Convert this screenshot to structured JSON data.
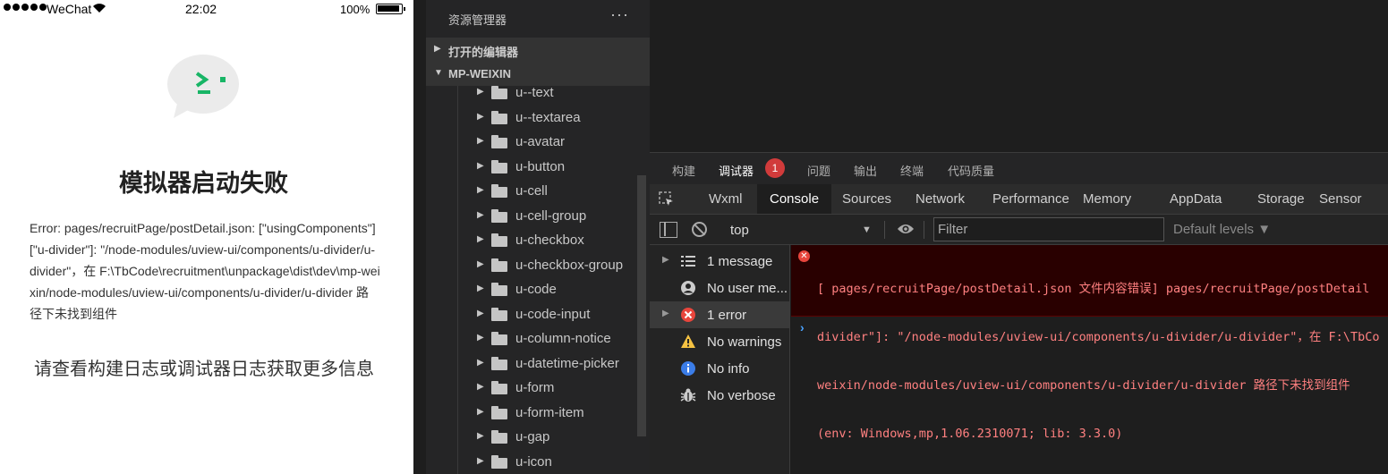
{
  "statusbar": {
    "carrier": "WeChat",
    "time": "22:02",
    "battery": "100%"
  },
  "simulator": {
    "title": "模拟器启动失败",
    "error": "Error: pages/recruitPage/postDetail.json: [\"usingComponents\"][\"u-divider\"]: \"/node-modules/uview-ui/components/u-divider/u-divider\"，在 F:\\TbCode\\recruitment\\unpackage\\dist\\dev\\mp-weixin/node-modules/uview-ui/components/u-divider/u-divider 路径下未找到组件",
    "hint": "请查看构建日志或调试器日志获取更多信息"
  },
  "explorer": {
    "title": "资源管理器",
    "more": "···",
    "sections": [
      {
        "label": "打开的编辑器",
        "arrow": "▶"
      },
      {
        "label": "MP-WEIXIN",
        "arrow": "▼"
      }
    ],
    "items": [
      "u--text",
      "u--textarea",
      "u-avatar",
      "u-button",
      "u-cell",
      "u-cell-group",
      "u-checkbox",
      "u-checkbox-group",
      "u-code",
      "u-code-input",
      "u-column-notice",
      "u-datetime-picker",
      "u-form",
      "u-form-item",
      "u-gap",
      "u-icon"
    ]
  },
  "panel_tabs": [
    "构建",
    "调试器",
    "问题",
    "输出",
    "终端",
    "代码质量"
  ],
  "panel_active": "调试器",
  "debug_badge": "1",
  "devtools_tabs": [
    "Wxml",
    "Console",
    "Sources",
    "Network",
    "Performance",
    "Memory",
    "AppData",
    "Storage",
    "Sensor"
  ],
  "devtools_active": "Console",
  "console_toolbar": {
    "context": "top",
    "filter_placeholder": "Filter",
    "levels": "Default levels ▼"
  },
  "console_sidebar": [
    {
      "label": "1 message",
      "icon": "list-icon",
      "expandable": true
    },
    {
      "label": "No user me...",
      "icon": "user-icon",
      "expandable": false
    },
    {
      "label": "1 error",
      "icon": "error-icon",
      "expandable": true,
      "selected": true
    },
    {
      "label": "No warnings",
      "icon": "warning-icon",
      "expandable": false
    },
    {
      "label": "No info",
      "icon": "info-icon",
      "expandable": false
    },
    {
      "label": "No verbose",
      "icon": "bug-icon",
      "expandable": false
    }
  ],
  "console_log": {
    "error_lines": [
      "[ pages/recruitPage/postDetail.json 文件内容错误] pages/recruitPage/postDetail",
      "divider\"]: \"/node-modules/uview-ui/components/u-divider/u-divider\"，在 F:\\TbCo",
      "weixin/node-modules/uview-ui/components/u-divider/u-divider 路径下未找到组件",
      "(env: Windows,mp,1.06.2310071; lib: 3.3.0)"
    ],
    "prompt": "›"
  },
  "colors": {
    "error_text": "#ff8080",
    "error_bg": "#290000",
    "badge": "#d13b3b"
  }
}
